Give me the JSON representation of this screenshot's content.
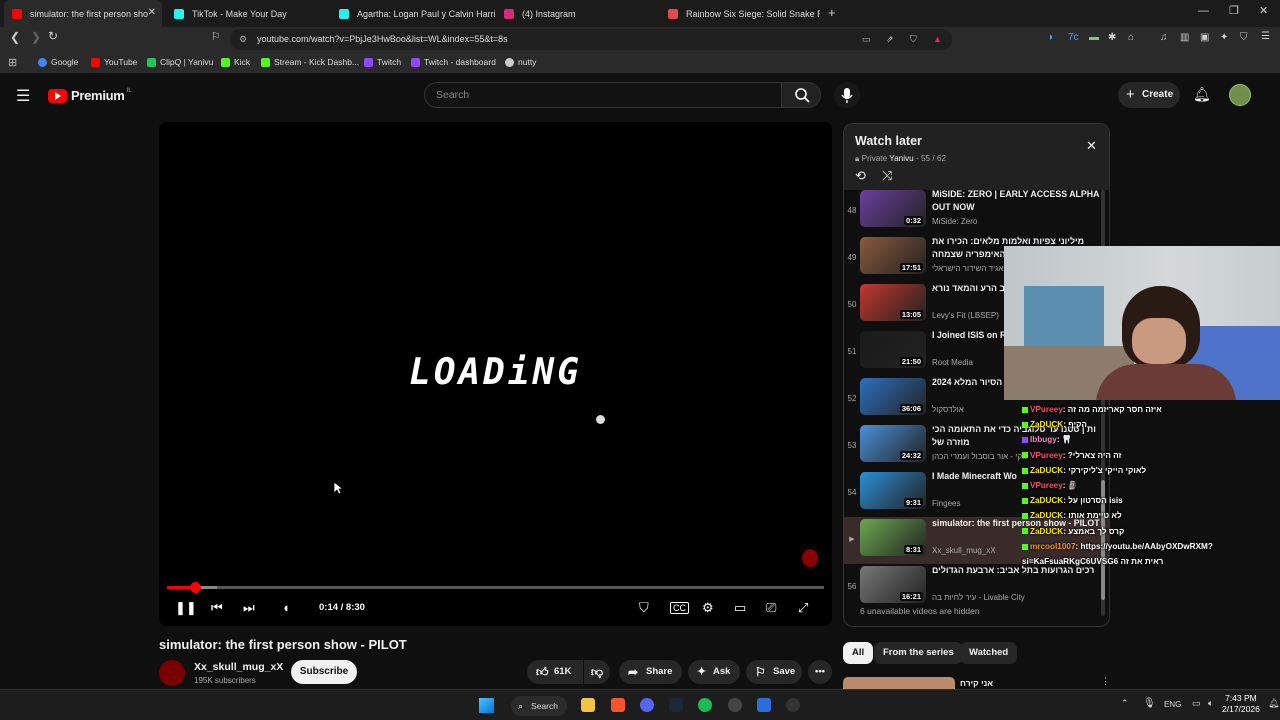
{
  "browser": {
    "tabs": [
      {
        "title": "simulator: the first person sho",
        "active": true,
        "color": "#ff0000"
      },
      {
        "title": "TikTok - Make Your Day",
        "active": false,
        "color": "#25f4ee"
      },
      {
        "title": "Agartha: Logan Paul y Calvin Harris s",
        "active": false,
        "color": "#25f4ee"
      },
      {
        "title": "(4) Instagram",
        "active": false,
        "color": "#d62976"
      },
      {
        "title": "Rainbow Six Siege: Solid Snake Reve",
        "active": false,
        "color": "#e14a4a"
      }
    ],
    "new_tab": "+",
    "url": "youtube.com/watch?v=PbjJe3HwBoo&list=WL&index=55&t=8s",
    "bookmarks": [
      {
        "label": "Google",
        "color": "#4285f4"
      },
      {
        "label": "YouTube",
        "color": "#ff0000"
      },
      {
        "label": "ClipQ | Yanivu",
        "color": "#22c55e"
      },
      {
        "label": "Kick",
        "color": "#53fc18"
      },
      {
        "label": "Stream - Kick Dashb...",
        "color": "#53fc18"
      },
      {
        "label": "Twitch",
        "color": "#9146ff"
      },
      {
        "label": "Twitch - dashboard",
        "color": "#9146ff"
      },
      {
        "label": "nutty",
        "color": "#cccccc"
      }
    ]
  },
  "youtube": {
    "logo_text": "Premium",
    "logo_sup": "IL",
    "search_placeholder": "Search",
    "create_label": "Create"
  },
  "player": {
    "overlay_text": "LOADiNG",
    "time": "0:14 / 8:30",
    "progress": 0.0275
  },
  "video": {
    "title": "simulator: the first person show - PILOT",
    "channel": "Xx_skull_mug_xX",
    "subscribers": "195K subscribers",
    "subscribe_label": "Subscribe",
    "likes": "61K",
    "share_label": "Share",
    "ask_label": "Ask",
    "save_label": "Save"
  },
  "playlist": {
    "title": "Watch later",
    "privacy": "Private",
    "owner": "Yanivu",
    "position": "- 55 / 62",
    "hidden_note": "6 unavailable videos are hidden",
    "items": [
      {
        "num": "48",
        "title": "MiSIDE: ZERO | EARLY ACCESS ALPHA OUT NOW",
        "channel": "MiSide: Zero",
        "duration": "0:32",
        "color": "#6b3fa0"
      },
      {
        "num": "49",
        "title": "מיליוני צפיות ואלמות מלאים: הכירו את האימפריה שצמחה",
        "channel": "תאגיד השידור הישראלי",
        "duration": "17:51",
        "color": "#8a5a3c"
      },
      {
        "num": "50",
        "title": "בא. הטוב הרע והמאד נורא!!",
        "channel": "Levy's Fit (LBSEP)",
        "duration": "13:05",
        "color": "#c0392b"
      },
      {
        "num": "51",
        "title": "I Joined ISIS on R Documentary",
        "channel": "Root Media",
        "duration": "21:50",
        "color": "#1a1a1a"
      },
      {
        "num": "52",
        "title": "הסוף של: הסיור המלא 2024",
        "channel": "אולדסקול",
        "duration": "36:06",
        "color": "#2e6fbf"
      },
      {
        "num": "53",
        "title": "ות | סטנו עד טלוגביה כדי את התאומה הכי מוזרה של",
        "channel": "זוקי - אור בוסבול ועמרי הכהן",
        "duration": "24:32",
        "color": "#4a90d9"
      },
      {
        "num": "54",
        "title": "I Made Minecraft Wo",
        "channel": "Fingees",
        "duration": "9:31",
        "color": "#2b8fd6"
      },
      {
        "num": "",
        "title": "simulator: the first person show - PILOT",
        "channel": "Xx_skull_mug_xX",
        "duration": "8:31",
        "color": "#6aa84f",
        "current": true
      },
      {
        "num": "56",
        "title": "רכים הגרועות בתל אביב: ארבעת הגדולים",
        "channel": "עיר לחיות בה - Livable City",
        "duration": "16:21",
        "color": "#777777"
      }
    ]
  },
  "chips": [
    "All",
    "From the series",
    "Watched"
  ],
  "next_item_text": "אני קירח",
  "chat": [
    {
      "user": "VPureey",
      "msg": ": איזה חסר קאריזמה מה זה",
      "color": "#ff4d6d",
      "badge": "#53fc18"
    },
    {
      "user": "ZaDUCK",
      "msg": ": הקיף",
      "color": "#ffe600",
      "badge": "#53fc18"
    },
    {
      "user": "lbbugy",
      "msg": ": 🦷",
      "color": "#ff88cc",
      "badge": "#9146ff"
    },
    {
      "user": "VPureey",
      "msg": ": ?זה היה צארלי",
      "color": "#ff4d6d",
      "badge": "#53fc18"
    },
    {
      "user": "ZaDUCK",
      "msg": ": לאוקי הייקי צ'ליקירקי",
      "color": "#ffe600",
      "badge": "#53fc18"
    },
    {
      "user": "VPureey",
      "msg": ": 🗿",
      "color": "#ff4d6d",
      "badge": "#53fc18"
    },
    {
      "user": "ZaDUCK",
      "msg": ": הסרטון על isis",
      "color": "#ffe600",
      "badge": "#53fc18"
    },
    {
      "user": "ZaDUCK",
      "msg": ": לא טיימת אותו",
      "color": "#ffe600",
      "badge": "#53fc18"
    },
    {
      "user": "ZaDUCK",
      "msg": ": קרס לך באמצע",
      "color": "#ffe600",
      "badge": "#53fc18"
    },
    {
      "user": "mrcool1007",
      "msg": ": https://youtu.be/AAbyOXDwRXM?",
      "color": "#ff9900",
      "badge": "#53fc18"
    },
    {
      "user": "si=KaFsuaRKgC6UVSG6",
      "msg": " ראית את זה",
      "color": "#ffffff",
      "badge": ""
    }
  ],
  "taskbar": {
    "search_label": "Search",
    "lang": "ENG",
    "time": "7:43 PM",
    "date": "2/17/2026"
  }
}
